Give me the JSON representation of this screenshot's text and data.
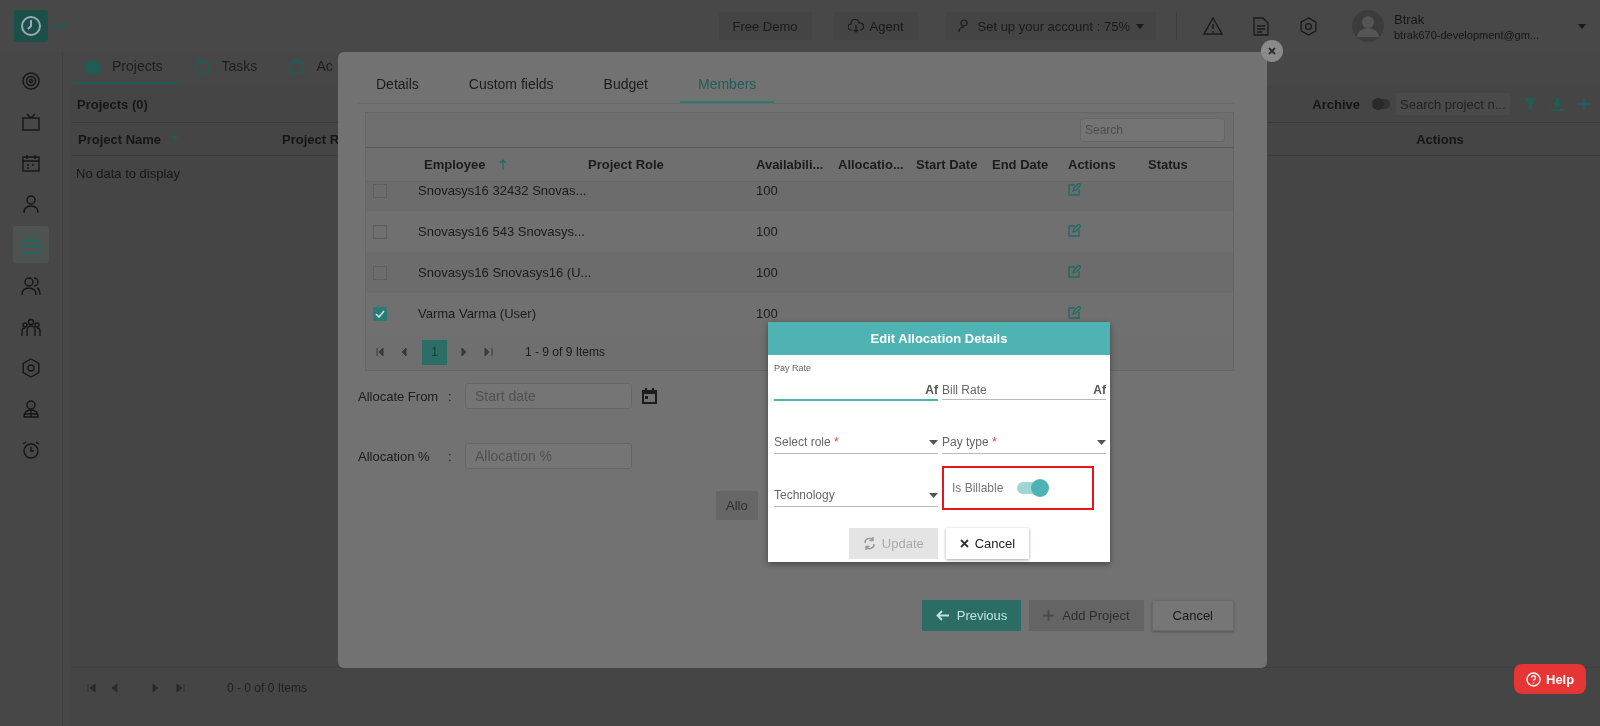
{
  "top_bar": {
    "free_demo": "Free Demo",
    "agent": "Agent",
    "setup": "Set up your account : 75%",
    "user": {
      "name": "Btrak",
      "email": "btrak670-development@gm..."
    }
  },
  "sidebar": {
    "items": [
      {
        "kind": "target",
        "selected": false
      },
      {
        "kind": "monitor",
        "selected": false
      },
      {
        "kind": "calendar",
        "selected": false
      },
      {
        "kind": "person",
        "selected": false
      },
      {
        "kind": "briefcase",
        "selected": true
      },
      {
        "kind": "people",
        "selected": false
      },
      {
        "kind": "group",
        "selected": false
      },
      {
        "kind": "gear",
        "selected": false
      },
      {
        "kind": "badge",
        "selected": false
      },
      {
        "kind": "alarm",
        "selected": false
      }
    ]
  },
  "page_tabs": [
    {
      "label": "Projects",
      "selected": true
    },
    {
      "label": "Tasks",
      "selected": false
    },
    {
      "label": "Ac",
      "selected": false
    }
  ],
  "projects_panel": {
    "title": "Projects (0)",
    "archive_label": "Archive",
    "archive_on": false,
    "search_placeholder": "Search project n...",
    "columns": [
      "Project Name",
      "Project R",
      "Actions"
    ],
    "empty": "No data to display",
    "pager": "0 - 0 of 0 Items"
  },
  "modal": {
    "tabs": [
      {
        "label": "Details",
        "selected": false
      },
      {
        "label": "Custom fields",
        "selected": false
      },
      {
        "label": "Budget",
        "selected": false
      },
      {
        "label": "Members",
        "selected": true
      }
    ],
    "grid": {
      "search_placeholder": "Search",
      "columns": [
        "Employee",
        "Project Role",
        "Availabili...",
        "Allocatio...",
        "Start Date",
        "End Date",
        "Actions",
        "Status"
      ],
      "rows": [
        {
          "checked": false,
          "employee": "Snovasys16 32432 Snovas...",
          "availability": "100"
        },
        {
          "checked": false,
          "employee": "Snovasys16 543 Snovasys...",
          "availability": "100"
        },
        {
          "checked": false,
          "employee": "Snovasys16 Snovasys16 (U...",
          "availability": "100"
        },
        {
          "checked": true,
          "employee": "Varma Varma (User)",
          "availability": "100"
        }
      ],
      "pager": {
        "page": "1",
        "summary": "1 - 9 of 9 Items"
      }
    },
    "allocate_from": {
      "label": "Allocate From",
      "colon": ":",
      "placeholder": "Start date"
    },
    "allocation": {
      "label": "Allocation %",
      "colon": ":",
      "placeholder": "Allocation %"
    },
    "allocate_button": "Allo",
    "buttons": {
      "previous": "Previous",
      "add_project": "Add Project",
      "cancel": "Cancel"
    }
  },
  "dialog": {
    "title": "Edit Allocation Details",
    "fields": [
      {
        "kind": "text",
        "label": "Pay Rate",
        "suffix": "Af",
        "focused": true
      },
      {
        "kind": "text",
        "placeholder": "Bill Rate",
        "suffix": "Af",
        "focused": false
      },
      {
        "kind": "select",
        "placeholder": "Select role",
        "required_mark": "*"
      },
      {
        "kind": "select",
        "placeholder": "Pay type",
        "required_mark": "*"
      },
      {
        "kind": "select",
        "placeholder": "Technology"
      },
      {
        "kind": "toggle",
        "label": "Is Billable",
        "on": true,
        "highlighted": true
      }
    ],
    "update": {
      "label": "Update",
      "disabled": true
    },
    "cancel": "Cancel"
  },
  "help": "Help"
}
